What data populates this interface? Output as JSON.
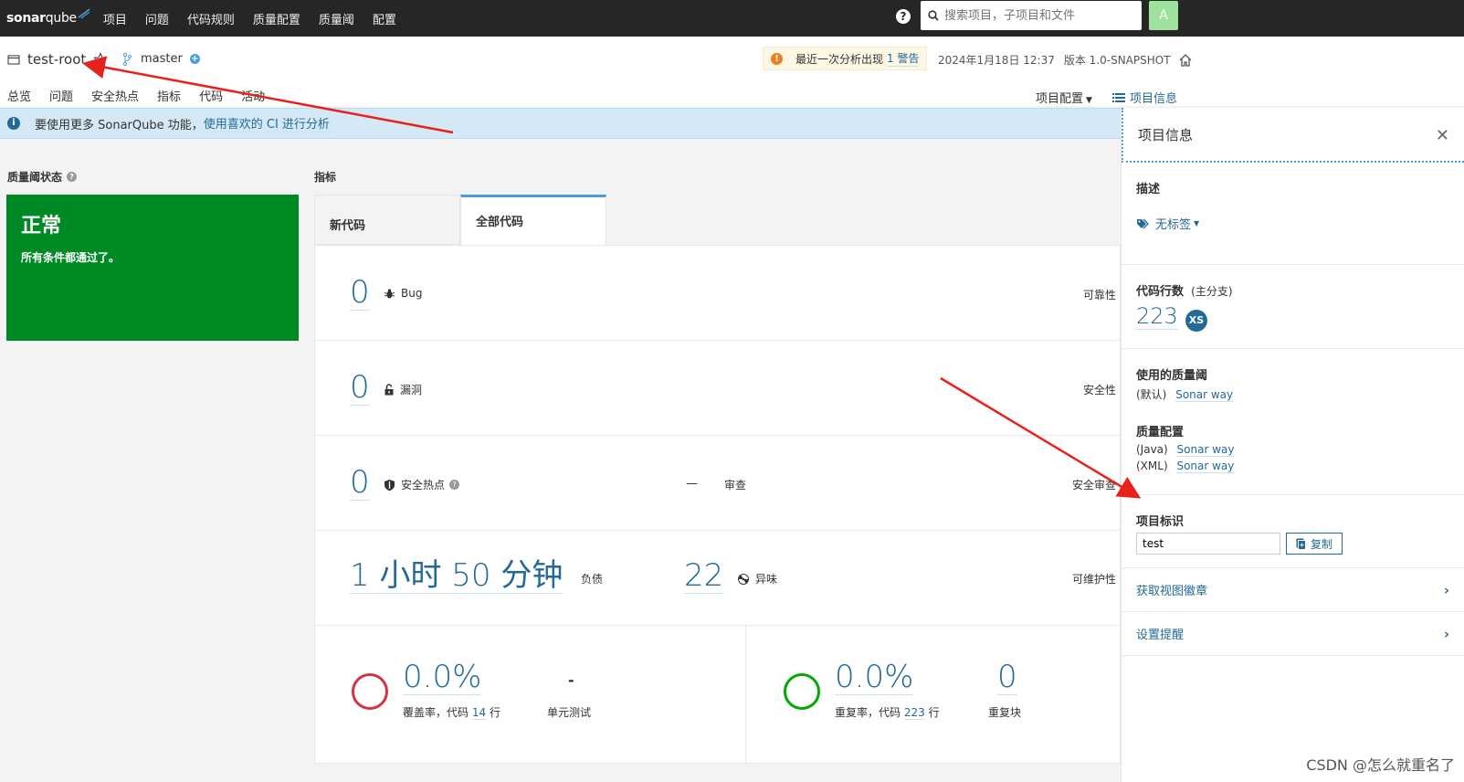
{
  "nav": {
    "logo_a": "sonar",
    "logo_b": "qube",
    "items": [
      "项目",
      "问题",
      "代码规则",
      "质量配置",
      "质量阈",
      "配置"
    ],
    "search_placeholder": "搜索项目，子项目和文件",
    "avatar": "A"
  },
  "project": {
    "name": "test-root",
    "branch": "master",
    "warning_text": "最近一次分析出现",
    "warning_link": "1 警告",
    "date": "2024年1月18日 12:37",
    "version": "版本 1.0-SNAPSHOT",
    "tabs": [
      "总览",
      "问题",
      "安全热点",
      "指标",
      "代码",
      "活动"
    ],
    "config": "项目配置",
    "info_link": "项目信息"
  },
  "banner": {
    "text": "要使用更多 SonarQube 功能，",
    "link": "使用喜欢的 CI 进行分析"
  },
  "quality_gate": {
    "title": "质量阈状态",
    "status": "正常",
    "subtitle": "所有条件都通过了。"
  },
  "measures": {
    "title": "指标",
    "tabs": [
      "新代码",
      "全部代码"
    ],
    "bugs": {
      "value": "0",
      "label": "Bug",
      "category": "可靠性"
    },
    "vulns": {
      "value": "0",
      "label": "漏洞",
      "category": "安全性"
    },
    "hotspots": {
      "value": "0",
      "label": "安全热点",
      "review_value": "—",
      "review_label": "审查",
      "category": "安全审查"
    },
    "debt": {
      "value": "1 小时 50 分钟",
      "label": "负债",
      "smells_value": "22",
      "smells_label": "异味",
      "category": "可维护性"
    },
    "coverage": {
      "value": "0.0%",
      "label_a": "覆盖率，代码",
      "lines": "14",
      "label_b": "行",
      "tests_value": "-",
      "tests_label": "单元测试"
    },
    "duplication": {
      "value": "0.0%",
      "label_a": "重复率，代码",
      "lines": "223",
      "label_b": "行",
      "blocks_value": "0",
      "blocks_label": "重复块"
    }
  },
  "side": {
    "title": "项目信息",
    "close": "✕",
    "desc_title": "描述",
    "tags": "无标签",
    "loc_title": "代码行数",
    "loc_sub": "(主分支)",
    "loc_value": "223",
    "loc_size": "XS",
    "qg_title": "使用的质量阈",
    "qg_default": "(默认)",
    "qg_name": "Sonar way",
    "qp_title": "质量配置",
    "qp_java": "(Java)",
    "qp_java_name": "Sonar way",
    "qp_xml": "(XML)",
    "qp_xml_name": "Sonar way",
    "key_title": "项目标识",
    "key_value": "test",
    "copy": "复制",
    "badge_link": "获取视图徽章",
    "notify_link": "设置提醒"
  },
  "watermark": "CSDN @怎么就重名了",
  "colors": {
    "nav_bg": "#262626",
    "qg_green": "#008a25",
    "link": "#236a97",
    "accent": "#4b9fd5",
    "annotation_red": "#e8211c"
  }
}
